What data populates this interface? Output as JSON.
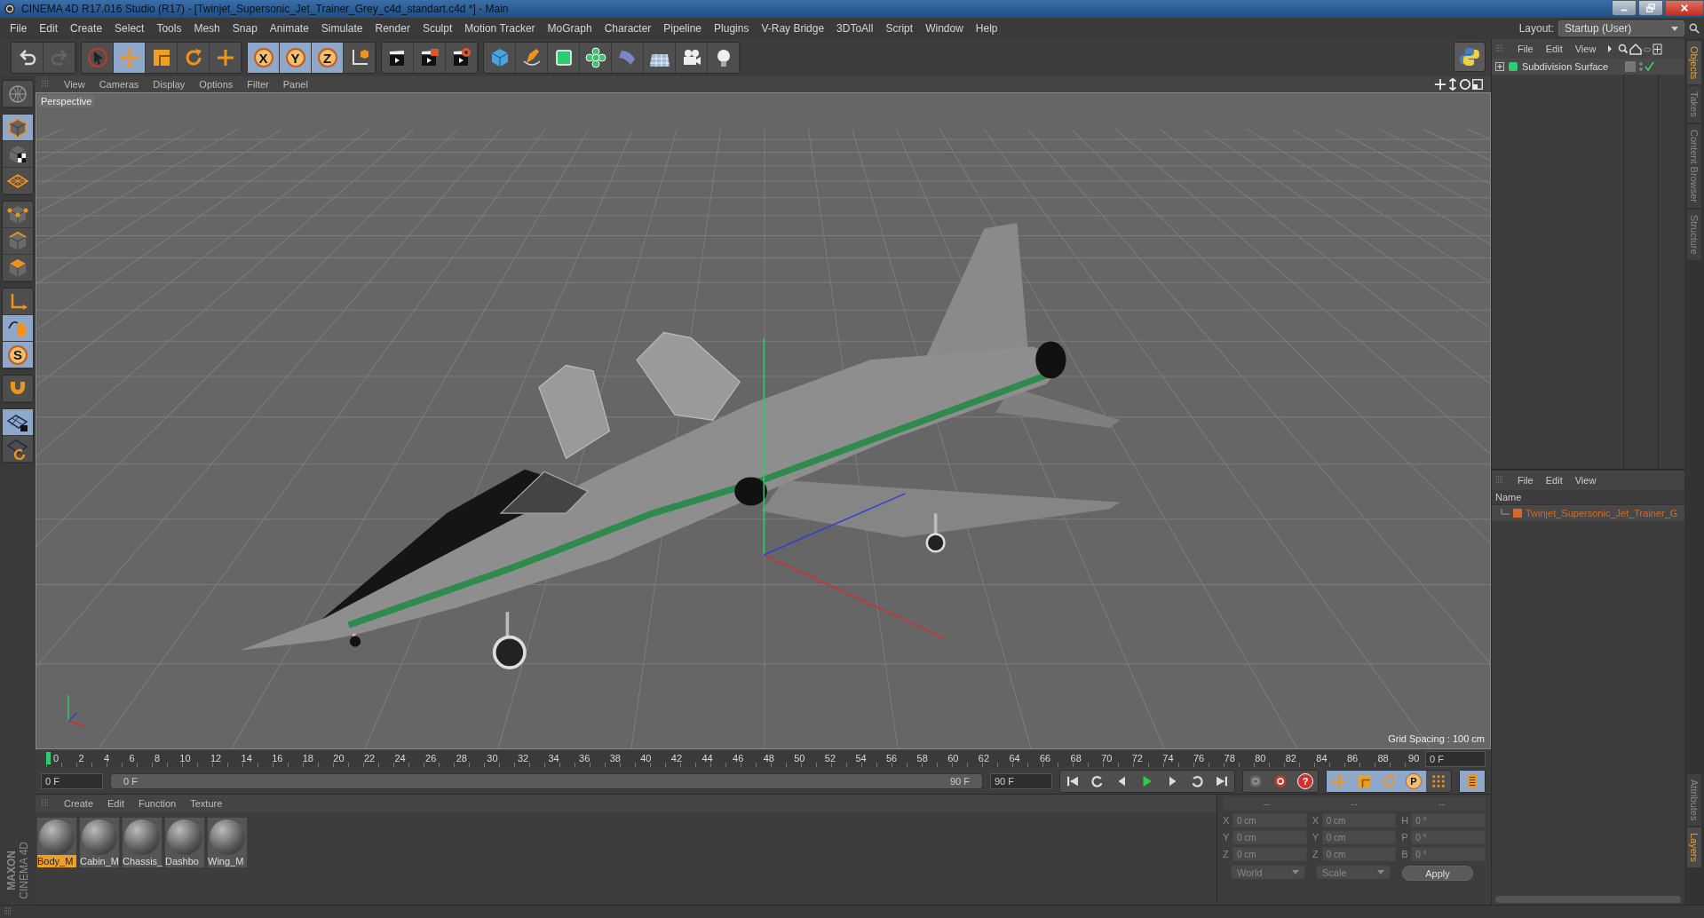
{
  "window": {
    "title": "CINEMA 4D R17.016 Studio (R17) - [Twinjet_Supersonic_Jet_Trainer_Grey_c4d_standart.c4d *] - Main"
  },
  "menu": [
    "File",
    "Edit",
    "Create",
    "Select",
    "Tools",
    "Mesh",
    "Snap",
    "Animate",
    "Simulate",
    "Render",
    "Sculpt",
    "Motion Tracker",
    "MoGraph",
    "Character",
    "Pipeline",
    "Plugins",
    "V-Ray Bridge",
    "3DToAll",
    "Script",
    "Window",
    "Help"
  ],
  "layout": {
    "label": "Layout:",
    "value": "Startup (User)"
  },
  "toolbar": [
    [
      {
        "kind": "undo",
        "selected": false
      },
      {
        "kind": "redo",
        "selected": false
      }
    ],
    [
      {
        "kind": "select",
        "selected": false
      },
      {
        "kind": "move",
        "selected": true
      },
      {
        "kind": "scale",
        "selected": false
      },
      {
        "kind": "rotate",
        "selected": false
      },
      {
        "kind": "transform",
        "selected": false
      }
    ],
    [
      {
        "kind": "x-axis",
        "label": "X",
        "selected": true
      },
      {
        "kind": "y-axis",
        "label": "Y",
        "selected": true
      },
      {
        "kind": "z-axis",
        "label": "Z",
        "selected": true
      },
      {
        "kind": "coords",
        "selected": false
      }
    ],
    [
      {
        "kind": "render-view",
        "selected": false
      },
      {
        "kind": "render",
        "selected": false
      },
      {
        "kind": "render-settings",
        "selected": false
      }
    ],
    [
      {
        "kind": "cube",
        "selected": false
      },
      {
        "kind": "pen",
        "selected": false
      },
      {
        "kind": "subdivision",
        "selected": false
      },
      {
        "kind": "cloner",
        "selected": false
      },
      {
        "kind": "deformer",
        "selected": false
      },
      {
        "kind": "floor",
        "selected": false
      },
      {
        "kind": "camera",
        "selected": false
      },
      {
        "kind": "light",
        "selected": false
      }
    ]
  ],
  "left_toolbar": [
    [
      {
        "kind": "world",
        "selected": false
      }
    ],
    [
      {
        "kind": "model",
        "selected": true
      },
      {
        "kind": "texture",
        "selected": false
      },
      {
        "kind": "workplane",
        "selected": false
      }
    ],
    [
      {
        "kind": "points",
        "selected": false
      },
      {
        "kind": "edges",
        "selected": false
      },
      {
        "kind": "polygons",
        "selected": false
      }
    ],
    [
      {
        "kind": "axis",
        "selected": false
      },
      {
        "kind": "tweak",
        "selected": true
      },
      {
        "kind": "solo",
        "label": "S",
        "selected": true
      }
    ],
    [
      {
        "kind": "snap",
        "selected": false
      }
    ],
    [
      {
        "kind": "lock-workplane",
        "selected": true
      },
      {
        "kind": "grid-snap",
        "selected": false
      }
    ]
  ],
  "viewport": {
    "menu": [
      "View",
      "Cameras",
      "Display",
      "Options",
      "Filter",
      "Panel"
    ],
    "camera": "Perspective",
    "grid_spacing": "Grid Spacing : 100 cm"
  },
  "timeline": {
    "ticks": [
      "0",
      "2",
      "4",
      "6",
      "8",
      "10",
      "12",
      "14",
      "16",
      "18",
      "20",
      "22",
      "24",
      "26",
      "28",
      "30",
      "32",
      "34",
      "36",
      "38",
      "40",
      "42",
      "44",
      "46",
      "48",
      "50",
      "52",
      "54",
      "56",
      "58",
      "60",
      "62",
      "64",
      "66",
      "68",
      "70",
      "72",
      "74",
      "76",
      "78",
      "80",
      "82",
      "84",
      "86",
      "88",
      "90"
    ],
    "playhead": {
      "level": 0
    },
    "current_frame": "0 F",
    "range": {
      "level": 1,
      "start": "0 F",
      "slider_start": "0 F",
      "slider_end": "90 F",
      "end": "90 F"
    }
  },
  "playback": [
    [
      {
        "kind": "go-start",
        "selected": false
      },
      {
        "kind": "prev-key",
        "selected": false
      },
      {
        "kind": "prev-frame",
        "selected": false
      },
      {
        "kind": "play",
        "selected": false
      },
      {
        "kind": "next-frame",
        "selected": false
      },
      {
        "kind": "next-key",
        "selected": false
      },
      {
        "kind": "go-end",
        "selected": false
      }
    ],
    [
      {
        "kind": "autokey",
        "selected": false
      },
      {
        "kind": "record",
        "selected": false
      },
      {
        "kind": "key-help",
        "label": "?",
        "selected": false
      }
    ],
    [
      {
        "kind": "move-key",
        "selected": true
      },
      {
        "kind": "scale-key",
        "selected": true
      },
      {
        "kind": "rotate-key",
        "selected": true
      },
      {
        "kind": "param-key",
        "label": "P",
        "selected": true
      },
      {
        "kind": "pla-key",
        "selected": false
      }
    ],
    [
      {
        "kind": "timeline",
        "selected": true
      }
    ]
  ],
  "materials": {
    "menu": [
      "Create",
      "Edit",
      "Function",
      "Texture"
    ],
    "items": [
      {
        "name": "Body_M",
        "selected": true
      },
      {
        "name": "Cabin_M",
        "selected": false
      },
      {
        "name": "Chassis_",
        "selected": false
      },
      {
        "name": "Dashbo",
        "selected": false
      },
      {
        "name": "Wing_M",
        "selected": false
      }
    ]
  },
  "coordinates": {
    "headers": [
      "--",
      "--",
      "--"
    ],
    "rows": [
      [
        {
          "axis": "X",
          "value": "0 cm"
        },
        {
          "axis": "X",
          "value": "0 cm"
        },
        {
          "axis": "H",
          "value": "0 °"
        }
      ],
      [
        {
          "axis": "Y",
          "value": "0 cm"
        },
        {
          "axis": "Y",
          "value": "0 cm"
        },
        {
          "axis": "P",
          "value": "0 °"
        }
      ],
      [
        {
          "axis": "Z",
          "value": "0 cm"
        },
        {
          "axis": "Z",
          "value": "0 cm"
        },
        {
          "axis": "B",
          "value": "0 °"
        }
      ]
    ],
    "dropdowns": [
      "World",
      "Scale"
    ],
    "apply": "Apply"
  },
  "brand": {
    "line1": "MAXON",
    "line2": "CINEMA 4D"
  },
  "objects": {
    "menu": [
      "File",
      "Edit",
      "View"
    ],
    "items": [
      {
        "name": "Subdivision Surface",
        "expanded": false,
        "enabled": true
      }
    ]
  },
  "layers": {
    "menu": [
      "File",
      "Edit",
      "View"
    ],
    "column": "Name",
    "rows": [
      {
        "name": "Twinjet_Supersonic_Jet_Trainer_G",
        "color": "#d4692b"
      }
    ]
  },
  "side_tabs": {
    "top": [
      {
        "label": "Objects",
        "selected": true
      },
      {
        "label": "Takes",
        "selected": false
      },
      {
        "label": "Content Browser",
        "selected": false
      },
      {
        "label": "Structure",
        "selected": false
      }
    ],
    "bottom": [
      {
        "label": "Attributes",
        "selected": false
      },
      {
        "label": "Layers",
        "selected": true
      }
    ]
  }
}
